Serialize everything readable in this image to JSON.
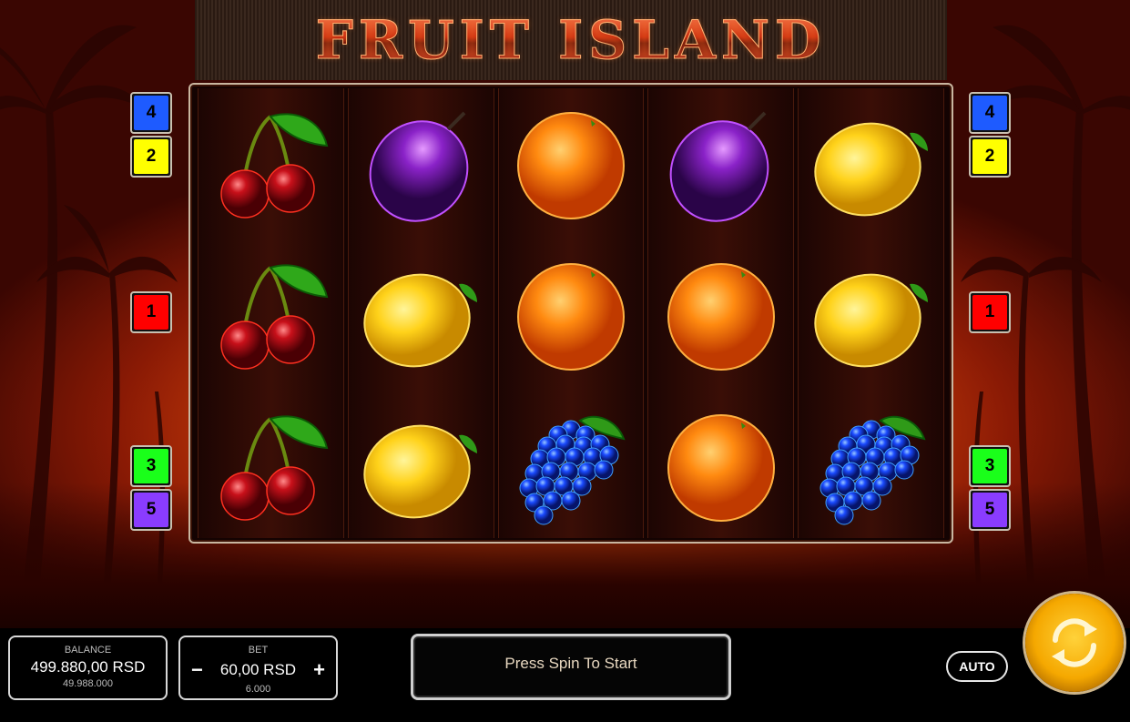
{
  "game": {
    "title": "FRUIT ISLAND"
  },
  "colors": {
    "line_blue": "#1e5bff",
    "line_yellow": "#ffff00",
    "line_red": "#ff0000",
    "line_green": "#1aff1a",
    "line_purple": "#8a3cff",
    "accent_gold": "#f5a800"
  },
  "paylines": {
    "left": [
      {
        "label": "4",
        "color": "#1e5bff"
      },
      {
        "label": "2",
        "color": "#ffff00"
      },
      {
        "label": "1",
        "color": "#ff0000"
      },
      {
        "label": "3",
        "color": "#1aff1a"
      },
      {
        "label": "5",
        "color": "#8a3cff"
      }
    ],
    "right": [
      {
        "label": "4",
        "color": "#1e5bff"
      },
      {
        "label": "2",
        "color": "#ffff00"
      },
      {
        "label": "1",
        "color": "#ff0000"
      },
      {
        "label": "3",
        "color": "#1aff1a"
      },
      {
        "label": "5",
        "color": "#8a3cff"
      }
    ]
  },
  "reels": [
    [
      "cherry",
      "cherry",
      "cherry"
    ],
    [
      "plum",
      "lemon",
      "lemon"
    ],
    [
      "orange",
      "orange",
      "grapes"
    ],
    [
      "plum",
      "orange",
      "orange"
    ],
    [
      "lemon",
      "lemon",
      "grapes"
    ]
  ],
  "balance": {
    "label": "BALANCE",
    "value": "499.880,00 RSD",
    "credits": "49.988.000"
  },
  "bet": {
    "label": "BET",
    "minus": "−",
    "value": "60,00 RSD",
    "plus": "+",
    "credits": "6.000"
  },
  "message": "Press Spin To Start",
  "auto_label": "AUTO",
  "spin_icon": "refresh-arrows-icon"
}
